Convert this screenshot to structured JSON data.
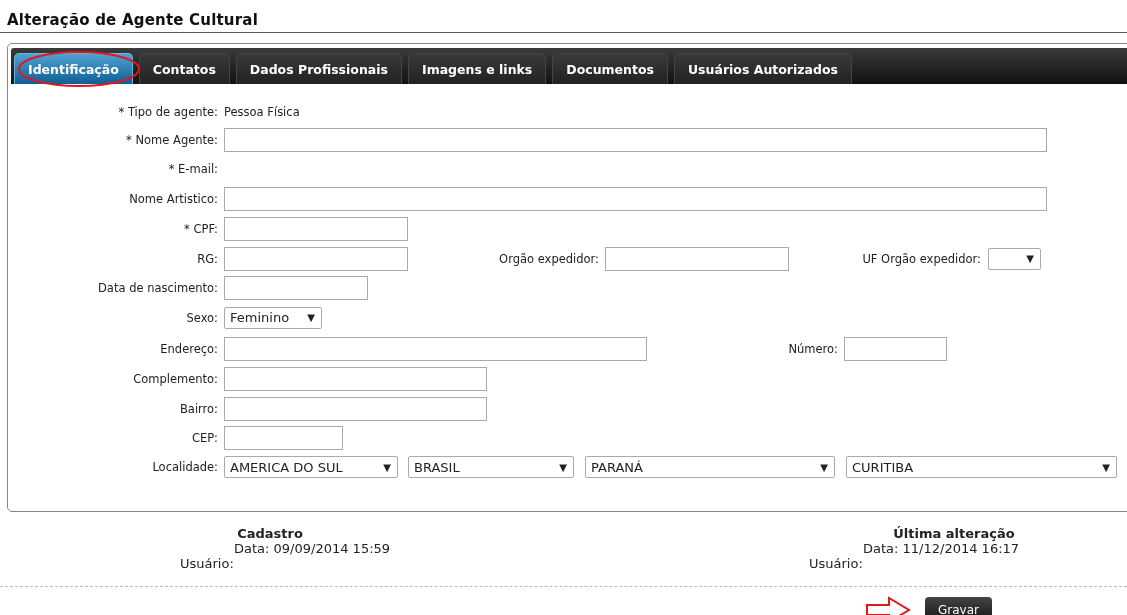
{
  "page_title": "Alteração de Agente Cultural",
  "tabs": [
    {
      "label": "Identificação",
      "selected": true
    },
    {
      "label": "Contatos",
      "selected": false
    },
    {
      "label": "Dados Profissionais",
      "selected": false
    },
    {
      "label": "Imagens e links",
      "selected": false
    },
    {
      "label": "Documentos",
      "selected": false
    },
    {
      "label": "Usuários Autorizados",
      "selected": false
    }
  ],
  "form_rows": [
    {
      "label": "* Tipo de agente:",
      "fields": [
        {
          "kind": "static",
          "value": "Pessoa Física"
        }
      ]
    },
    {
      "label": "* Nome Agente:",
      "fields": [
        {
          "kind": "text"
        }
      ]
    },
    {
      "label": "* E-mail:",
      "fields": []
    },
    {
      "label": "Nome Artistico:",
      "fields": [
        {
          "kind": "text"
        }
      ]
    },
    {
      "label": "* CPF:",
      "fields": [
        {
          "kind": "text"
        }
      ]
    },
    {
      "label": "RG:",
      "fields": [
        {
          "kind": "text"
        },
        {
          "kind": "label",
          "value": "Orgão expedidor:"
        },
        {
          "kind": "text"
        },
        {
          "kind": "label",
          "value": "UF Orgão expedidor:"
        },
        {
          "kind": "select"
        }
      ]
    },
    {
      "label": "Data de nascimento:",
      "fields": [
        {
          "kind": "text"
        }
      ]
    },
    {
      "label": "Sexo:",
      "fields": [
        {
          "kind": "select",
          "value": "Feminino"
        }
      ]
    },
    {
      "label": "Endereço:",
      "fields": [
        {
          "kind": "text"
        },
        {
          "kind": "label",
          "value": "Número:"
        },
        {
          "kind": "text"
        }
      ]
    },
    {
      "label": "Complemento:",
      "fields": [
        {
          "kind": "text"
        }
      ]
    },
    {
      "label": "Bairro:",
      "fields": [
        {
          "kind": "text"
        }
      ]
    },
    {
      "label": "CEP:",
      "fields": [
        {
          "kind": "text"
        }
      ]
    },
    {
      "label": "Localidade:",
      "fields": [
        {
          "kind": "select",
          "value": "AMERICA DO SUL"
        },
        {
          "kind": "select",
          "value": "BRASIL"
        },
        {
          "kind": "select",
          "value": "PARANÁ"
        },
        {
          "kind": "select",
          "value": "CURITIBA"
        }
      ]
    }
  ],
  "footer": [
    {
      "heading": "Cadastro",
      "date": "Data: 09/09/2014 15:59",
      "user": "Usuário:"
    },
    {
      "heading": "Última alteração",
      "date": "Data: 11/12/2014 16:17",
      "user": "Usuário:"
    }
  ],
  "save_button": "Gravar",
  "select_caret": "▼"
}
